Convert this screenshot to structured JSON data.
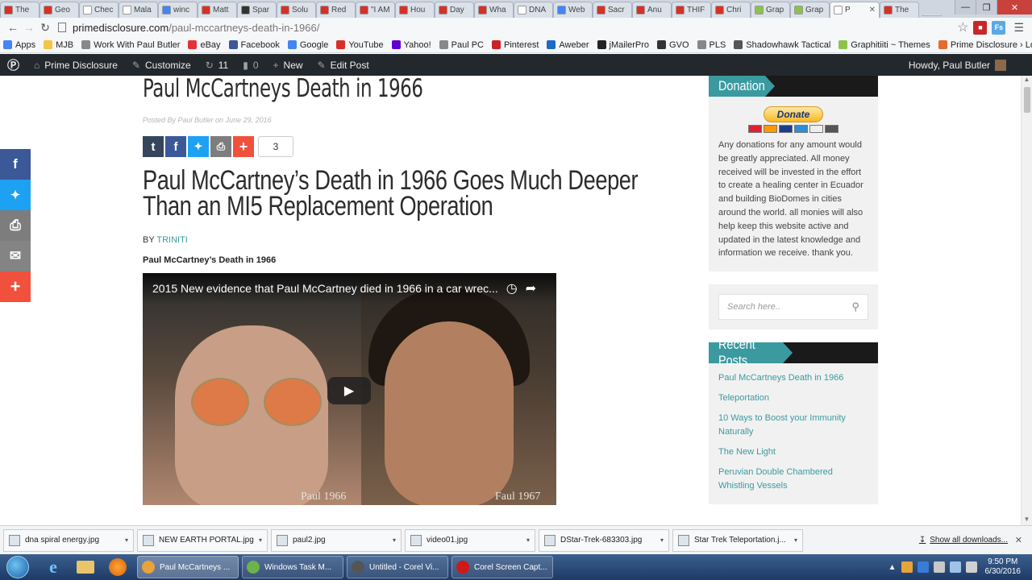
{
  "browser": {
    "tabs": [
      {
        "label": "The",
        "color": "#d93025"
      },
      {
        "label": "Geo",
        "color": "#d93025"
      },
      {
        "label": "Chec",
        "color": "#ffffff"
      },
      {
        "label": "Mala",
        "color": "#ffffff"
      },
      {
        "label": "winc",
        "color": "#4285f4"
      },
      {
        "label": "Matt",
        "color": "#d93025"
      },
      {
        "label": "Spar",
        "color": "#333333"
      },
      {
        "label": "Solu",
        "color": "#d93025"
      },
      {
        "label": "Red",
        "color": "#d93025"
      },
      {
        "label": "\"I AM",
        "color": "#d93025"
      },
      {
        "label": "Hou",
        "color": "#d93025"
      },
      {
        "label": "Day",
        "color": "#d93025"
      },
      {
        "label": "Wha",
        "color": "#d93025"
      },
      {
        "label": "DNA",
        "color": "#ffffff"
      },
      {
        "label": "Web",
        "color": "#4285f4"
      },
      {
        "label": "Sacr",
        "color": "#d93025"
      },
      {
        "label": "Anu",
        "color": "#d93025"
      },
      {
        "label": "THIF",
        "color": "#d93025"
      },
      {
        "label": "Chri",
        "color": "#d93025"
      },
      {
        "label": "Grap",
        "color": "#8bc34a"
      },
      {
        "label": "Grap",
        "color": "#8bc34a"
      },
      {
        "label": "P",
        "color": "#ffffff",
        "active": true
      },
      {
        "label": "The",
        "color": "#d93025"
      }
    ],
    "url_host": "primedisclosure.com",
    "url_path": "/paul-mccartneys-death-in-1966/",
    "bookmarks": [
      {
        "label": "Apps",
        "color": "#4285f4"
      },
      {
        "label": "MJB",
        "color": "#f4c542"
      },
      {
        "label": "Work With Paul Butler",
        "color": "#888888"
      },
      {
        "label": "eBay",
        "color": "#e53238"
      },
      {
        "label": "Facebook",
        "color": "#3b5998"
      },
      {
        "label": "Google",
        "color": "#4285f4"
      },
      {
        "label": "YouTube",
        "color": "#d93025"
      },
      {
        "label": "Yahoo!",
        "color": "#5f01d1"
      },
      {
        "label": "Paul PC",
        "color": "#888888"
      },
      {
        "label": "Pinterest",
        "color": "#cb2027"
      },
      {
        "label": "Aweber",
        "color": "#1b6ac9"
      },
      {
        "label": "jMailerPro",
        "color": "#222222"
      },
      {
        "label": "GVO",
        "color": "#333333"
      },
      {
        "label": "PLS",
        "color": "#888888"
      },
      {
        "label": "Shadowhawk Tactical",
        "color": "#555555"
      },
      {
        "label": "Graphitiiti ~ Themes",
        "color": "#8bc34a"
      },
      {
        "label": "Prime Disclosure › Lo",
        "color": "#e66a2c"
      }
    ]
  },
  "adminbar": {
    "site": "Prime Disclosure",
    "customize": "Customize",
    "updates": "11",
    "comments": "0",
    "new": "New",
    "edit": "Edit Post",
    "howdy": "Howdy, Paul Butler"
  },
  "article": {
    "title": "Paul McCartneys Death in 1966",
    "meta": "Posted By Paul Butler on June 29, 2016",
    "share_count": "3",
    "headline": "Paul McCartney’s Death in 1966 Goes Much Deeper Than an MI5 Replacement Operation",
    "by_label": "BY",
    "author": "TRINITI",
    "subhead": "Paul McCartney’s Death in 1966",
    "video_title": "2015 New evidence that Paul McCartney died in 1966 in a car wrec...",
    "caption_left": "Paul 1966",
    "caption_right": "Faul 1967"
  },
  "sidebar": {
    "donations_title": "Donations",
    "donate_button": "Donate",
    "donate_text": "Any donations for any amount would be greatly appreciated. All money received will be invested in the effort to create a healing center in Ecuador and building BioDomes in cities around the world. all monies will also help keep this website active and updated in the latest knowledge and information we receive. thank you.",
    "search_placeholder": "Search here..",
    "recent_title": "Recent Posts",
    "recent_posts": [
      "Paul McCartneys Death in 1966",
      "Teleportation",
      "10 Ways to Boost your Immunity Naturally",
      "The New Light",
      "Peruvian Double Chambered Whistling Vessels"
    ]
  },
  "downloads": {
    "items": [
      "dna spiral energy.jpg",
      "NEW EARTH PORTAL.jpg",
      "paul2.jpg",
      "video01.jpg",
      "DStar-Trek-683303.jpg",
      "Star Trek Teleportation.j..."
    ],
    "show_all": "Show all downloads..."
  },
  "taskbar": {
    "tasks": [
      {
        "label": "Paul McCartneys ...",
        "color": "#e8a33a",
        "active": true
      },
      {
        "label": "Windows Task M...",
        "color": "#6bb34a"
      },
      {
        "label": "Untitled - Corel Vi...",
        "color": "#555555"
      },
      {
        "label": "Corel Screen Capt...",
        "color": "#d01818"
      }
    ],
    "time": "9:50 PM",
    "date": "6/30/2016"
  },
  "colors": {
    "accent": "#3a9aa0",
    "admin_bg": "#23282d",
    "tumblr": "#35465c",
    "facebook": "#3b5998",
    "twitter": "#1da1f2",
    "print": "#7d7d7d",
    "email": "#848484",
    "more": "#f0513c"
  }
}
